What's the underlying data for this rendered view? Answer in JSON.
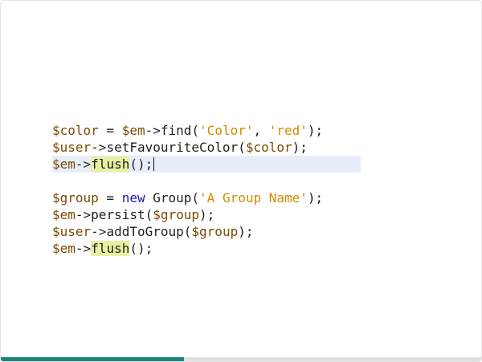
{
  "code": {
    "line1": {
      "var": "$color",
      "op": " = ",
      "obj": "$em",
      "call": "->find(",
      "arg1": "'Color'",
      "sep": ", ",
      "arg2": "'red'",
      "end": ");"
    },
    "line2": {
      "var": "$user",
      "call": "->setFavouriteColor(",
      "arg": "$color",
      "end": ");"
    },
    "line3": {
      "obj": "$em",
      "arrow": "->",
      "method": "flush",
      "end": "();"
    },
    "line5": {
      "var": "$group",
      "op": " = ",
      "kw": "new",
      "cls": " Group(",
      "arg": "'A Group Name'",
      "end": ");"
    },
    "line6": {
      "obj": "$em",
      "call": "->persist(",
      "arg": "$group",
      "end": ");"
    },
    "line7": {
      "var": "$user",
      "call": "->addToGroup(",
      "arg": "$group",
      "end": ");"
    },
    "line8": {
      "obj": "$em",
      "arrow": "->",
      "method": "flush",
      "end": "();"
    }
  },
  "progress": {
    "fraction": 0.38,
    "fill_color": "#15867c",
    "track_color": "#e0e0e0"
  }
}
